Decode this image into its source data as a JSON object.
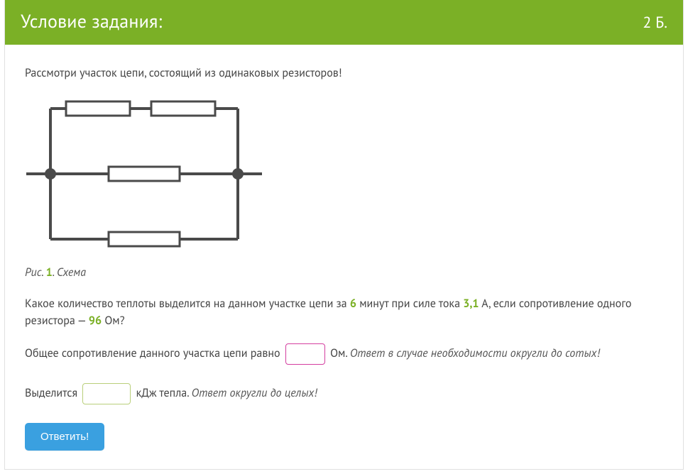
{
  "header": {
    "title": "Условие задания:",
    "points": "2 Б."
  },
  "intro": "Рассмотри участок цепи, состоящий из одинаковых резисторов!",
  "figure": {
    "caption_prefix": "Рис. ",
    "caption_num": "1",
    "caption_suffix": ". Схема"
  },
  "question": {
    "p1_a": "Какое количество теплоты выделится на данном участке цепи за ",
    "time": "6",
    "p1_b": " минут при силе тока ",
    "current": "3,1",
    "p1_c": " А, если сопротивление одного резистора — ",
    "resistance": "96",
    "p1_d": " Ом?"
  },
  "answer1": {
    "before": "Общее сопротивление данного участка цепи равно ",
    "after_unit": " Ом. ",
    "hint": "Ответ в случае необходимости округли до сотых!",
    "value": ""
  },
  "answer2": {
    "before": "Выделится ",
    "after_unit": " кДж тепла. ",
    "hint": "Ответ округли до целых!",
    "value": ""
  },
  "submit": "Ответить!"
}
